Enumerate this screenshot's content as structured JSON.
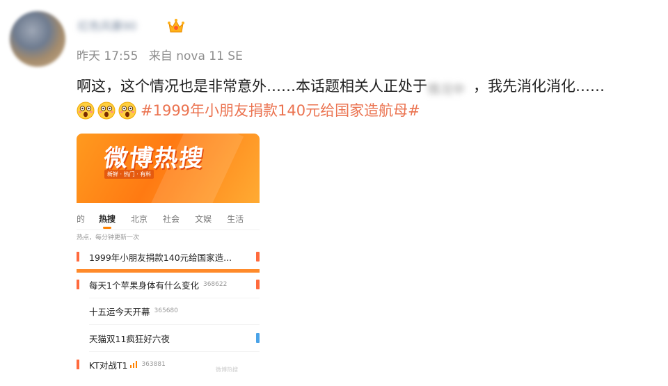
{
  "post": {
    "username": "红色风暴90",
    "meta": {
      "time": "昨天 17:55",
      "source": "来自 nova 11 SE"
    },
    "text_line1_before": "啊这，这个情况也是非常意外……本话题相关人正处于",
    "text_line1_blurred": "情况中",
    "text_line1_after": "，我先消化消化……",
    "hashtag": "#1999年小朋友捐款140元给国家造航母#"
  },
  "card": {
    "banner_title": "微博热搜",
    "banner_sub": "新鲜 · 热门 · 有料",
    "tabs": [
      "的",
      "热搜",
      "北京",
      "社会",
      "文娱",
      "生活"
    ],
    "active_tab": "热搜",
    "notice": "热点，每分钟更新一次",
    "items": [
      {
        "title": "1999年小朋友捐款140元给国家造...",
        "count": ""
      },
      {
        "title": "每天1个苹果身体有什么变化",
        "count": "368622"
      },
      {
        "title": "十五运今天开幕",
        "count": "365680"
      },
      {
        "title": "天猫双11疯狂好六夜",
        "count": ""
      },
      {
        "title": "KT对战T1",
        "count": "363881"
      }
    ],
    "watermark": "微博热搜"
  },
  "colors": {
    "accent": "#ff8200",
    "hashtag": "#eb7350",
    "meta": "#8d8d8d"
  }
}
